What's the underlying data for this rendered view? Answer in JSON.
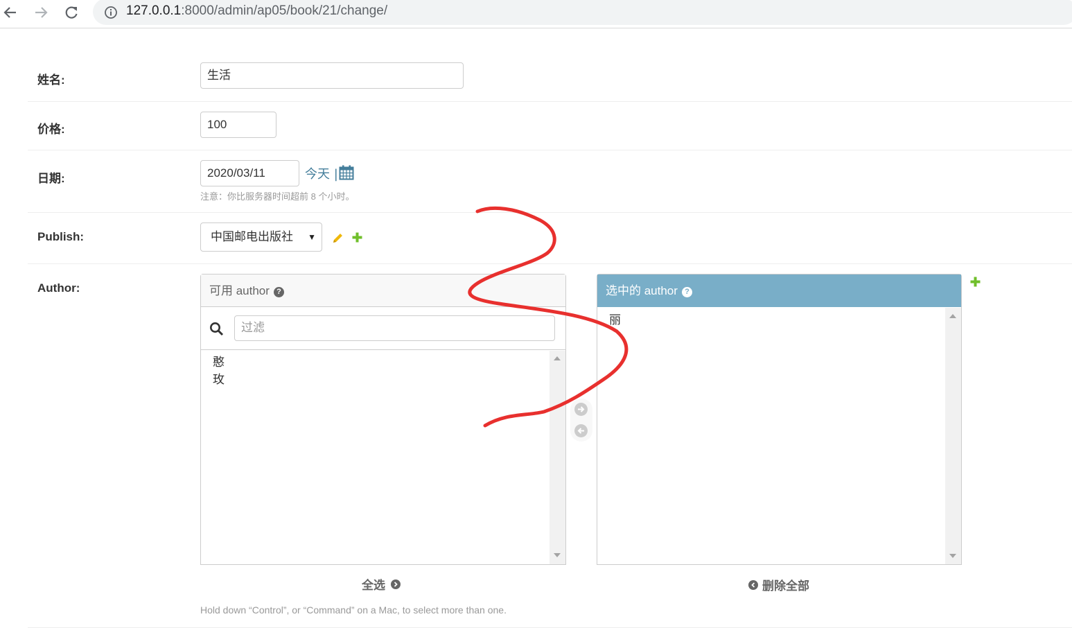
{
  "browser": {
    "url_host": "127.0.0.1",
    "url_rest": ":8000/admin/ap05/book/21/change/"
  },
  "form": {
    "name_label": "姓名:",
    "name_value": "生活",
    "price_label": "价格:",
    "price_value": "100",
    "date_label": "日期:",
    "date_value": "2020/03/11",
    "today_link": "今天",
    "date_separator": "|",
    "date_note": "注意：你比服务器时间超前 8 个小时。",
    "publish_label": "Publish:",
    "publish_selected": "中国邮电出版社",
    "author_label": "Author:",
    "available": {
      "title": "可用 author",
      "filter_placeholder": "过滤",
      "items": [
        "憨",
        "玫"
      ],
      "choose_all": "全选"
    },
    "chosen": {
      "title": "选中的 author",
      "items": [
        "丽"
      ],
      "remove_all": "删除全部"
    },
    "help_text": "Hold down “Control”, or “Command” on a Mac, to select more than one."
  },
  "colors": {
    "header_blue": "#79aec8",
    "link": "#447e9b",
    "add_green": "#70bf2b",
    "edit_yellow": "#efb80b",
    "annotation_red": "#e8302e"
  }
}
